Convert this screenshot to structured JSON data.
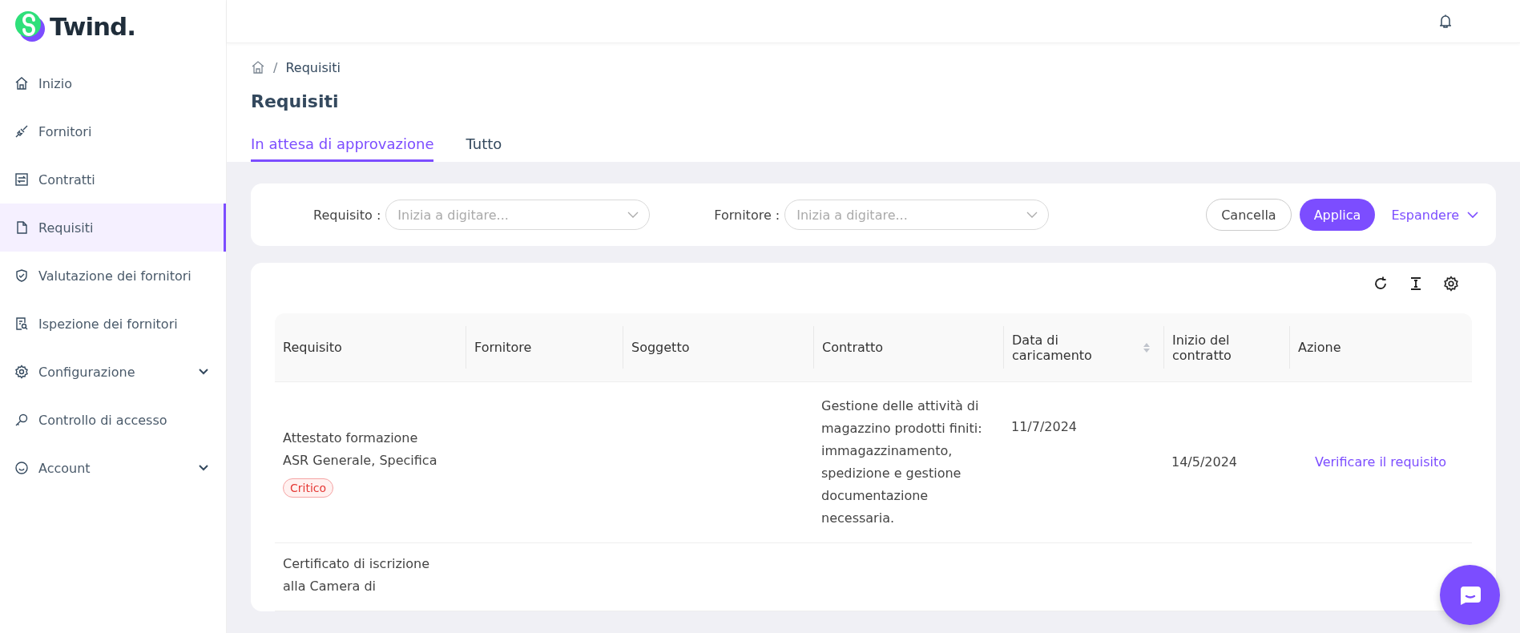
{
  "logo": {
    "text": "Twind."
  },
  "sidebar": {
    "items": [
      {
        "label": "Inizio",
        "selected": false,
        "expandable": false
      },
      {
        "label": "Fornitori",
        "selected": false,
        "expandable": false
      },
      {
        "label": "Contratti",
        "selected": false,
        "expandable": false
      },
      {
        "label": "Requisiti",
        "selected": true,
        "expandable": false
      },
      {
        "label": "Valutazione dei fornitori",
        "selected": false,
        "expandable": false
      },
      {
        "label": "Ispezione dei fornitori",
        "selected": false,
        "expandable": false
      },
      {
        "label": "Configurazione",
        "selected": false,
        "expandable": true
      },
      {
        "label": "Controllo di accesso",
        "selected": false,
        "expandable": false
      },
      {
        "label": "Account",
        "selected": false,
        "expandable": true
      }
    ]
  },
  "breadcrumb": {
    "separator": "/",
    "current": "Requisiti"
  },
  "page_title": "Requisiti",
  "tabs": [
    {
      "label": "In attesa di approvazione",
      "selected": true
    },
    {
      "label": "Tutto",
      "selected": false
    }
  ],
  "filters": {
    "fields": [
      {
        "label": "Requisito :",
        "placeholder": "Inizia a digitare..."
      },
      {
        "label": "Fornitore :",
        "placeholder": "Inizia a digitare..."
      }
    ],
    "cancel": "Cancella",
    "apply": "Applica",
    "expand": "Espandere"
  },
  "table": {
    "columns": [
      {
        "label": "Requisito",
        "sortable": false
      },
      {
        "label": "Fornitore",
        "sortable": false
      },
      {
        "label": "Soggetto",
        "sortable": false
      },
      {
        "label": "Contratto",
        "sortable": false
      },
      {
        "label": "Data di caricamento",
        "sortable": true
      },
      {
        "label": "Inizio del contratto",
        "sortable": false
      },
      {
        "label": "Azione",
        "sortable": false
      }
    ],
    "rows": [
      {
        "requisito": "Attestato formazione ASR Generale, Specifica",
        "tag": "Critico",
        "contratto": "Gestione delle attività di magazzino prodotti finiti: immagazzinamento, spedizione e gestione documentazione necessaria.",
        "data": "11/7/2024",
        "inizio": "14/5/2024",
        "azione": "Verificare il requisito"
      },
      {
        "requisito": "Certificato di iscrizione alla Camera di"
      }
    ]
  }
}
